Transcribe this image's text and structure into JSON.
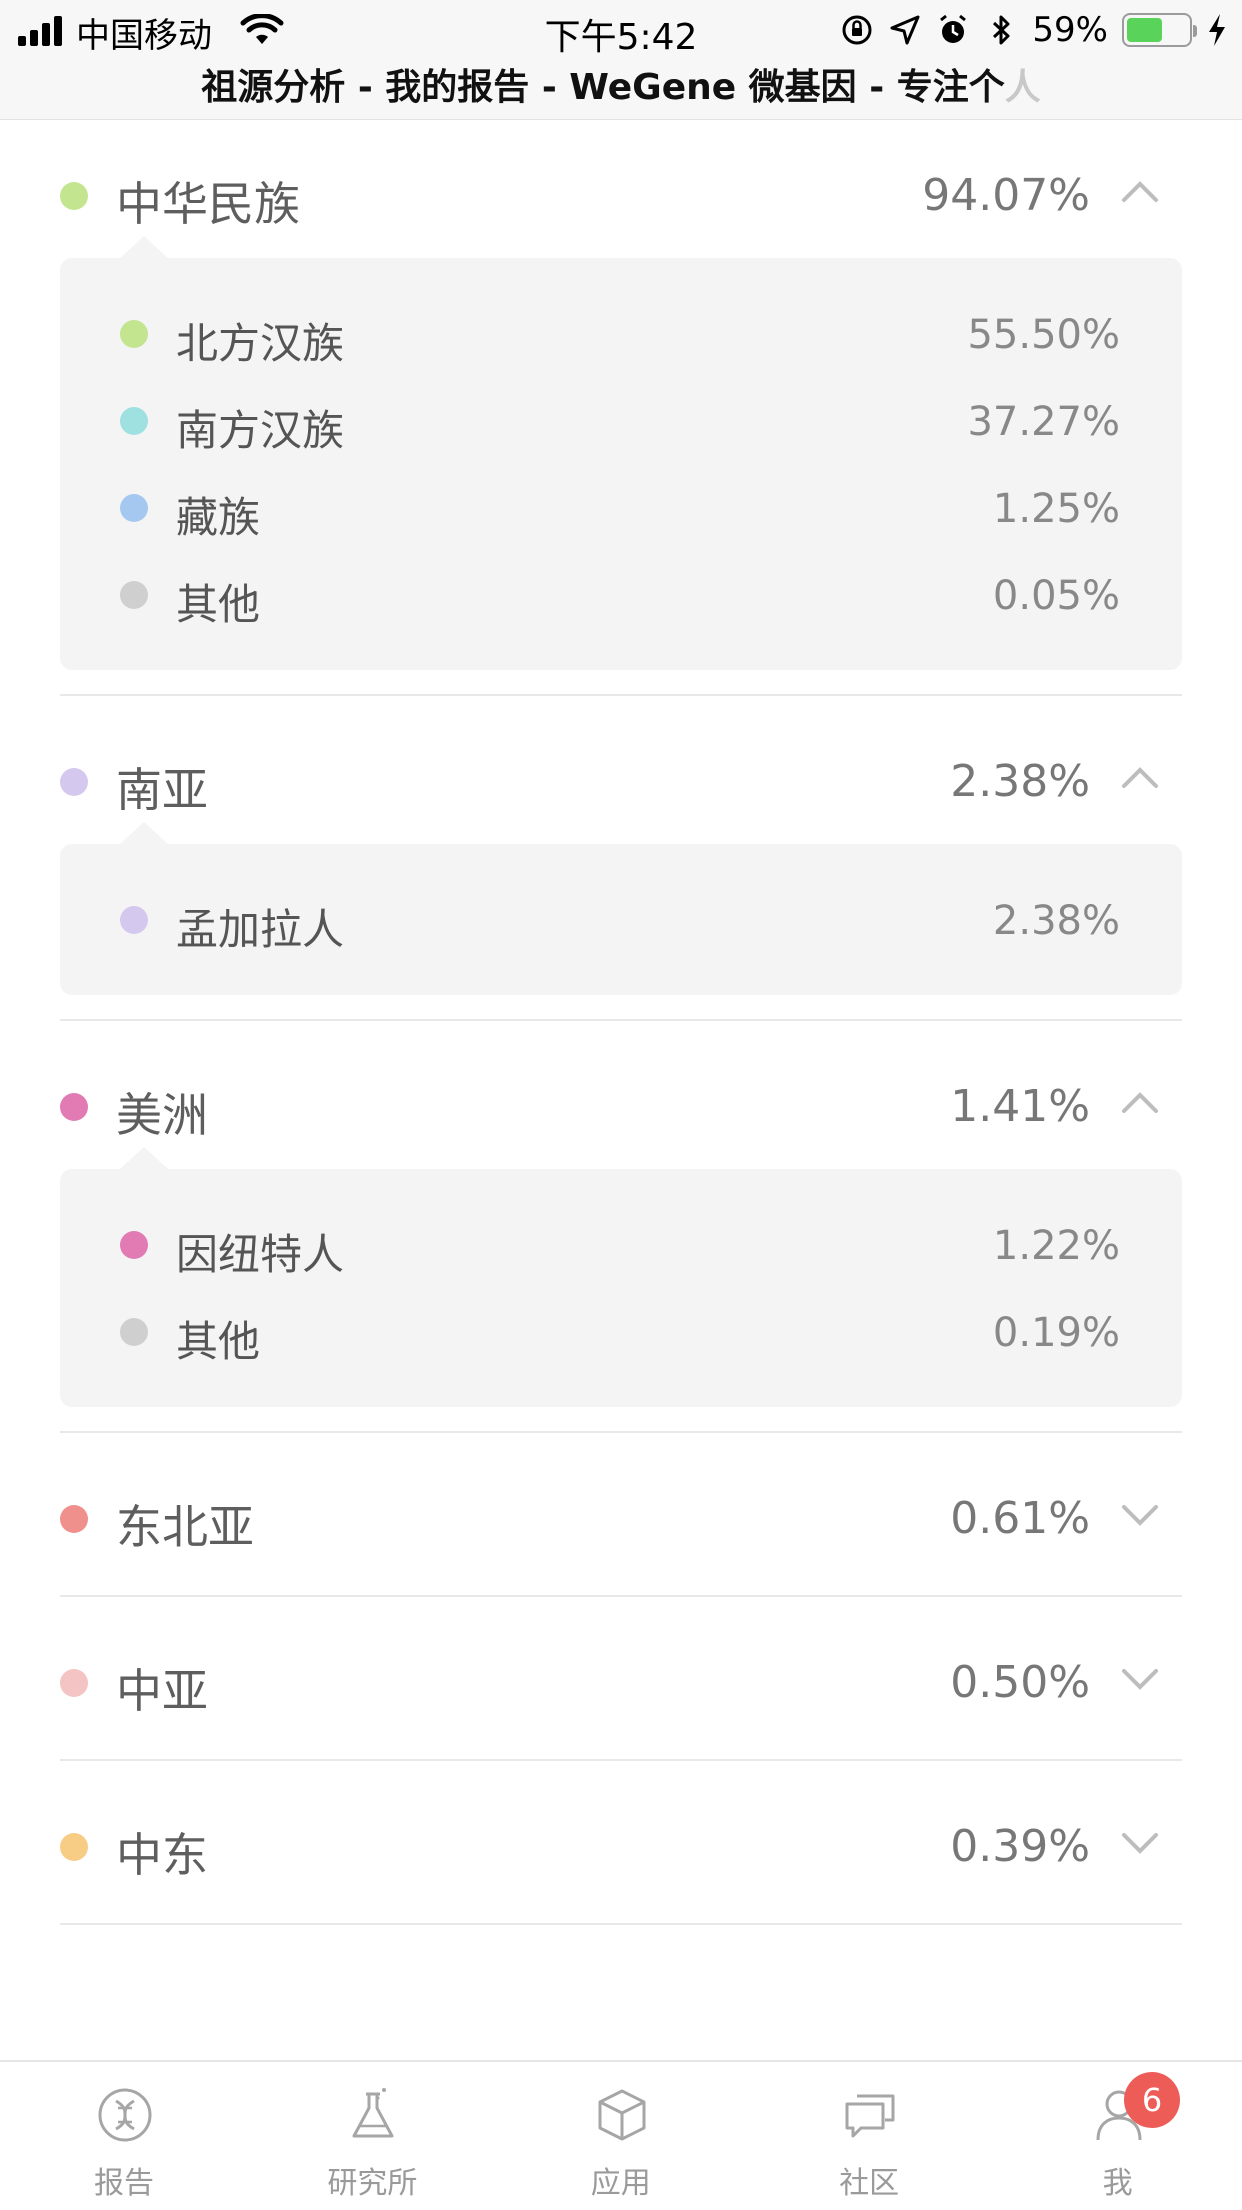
{
  "status_bar": {
    "carrier": "中国移动",
    "time": "下午5:42",
    "battery_percent": "59%",
    "battery_level": 0.59,
    "battery_color": "#5ad35a"
  },
  "page_title": {
    "text": "祖源分析 - 我的报告 - WeGene 微基因 - 专注个",
    "faded_tail": "人"
  },
  "groups": [
    {
      "name": "中华民族",
      "percent": "94.07%",
      "color": "#c4e58f",
      "expanded": true,
      "items": [
        {
          "name": "北方汉族",
          "percent": "55.50%",
          "color": "#c4e58f"
        },
        {
          "name": "南方汉族",
          "percent": "37.27%",
          "color": "#9fe0e0"
        },
        {
          "name": "藏族",
          "percent": "1.25%",
          "color": "#a4c8f0"
        },
        {
          "name": "其他",
          "percent": "0.05%",
          "color": "#cfcfcf"
        }
      ]
    },
    {
      "name": "南亚",
      "percent": "2.38%",
      "color": "#d5c8ef",
      "expanded": true,
      "items": [
        {
          "name": "孟加拉人",
          "percent": "2.38%",
          "color": "#d5c8ef"
        }
      ]
    },
    {
      "name": "美洲",
      "percent": "1.41%",
      "color": "#e27bb4",
      "expanded": true,
      "items": [
        {
          "name": "因纽特人",
          "percent": "1.22%",
          "color": "#e27bb4"
        },
        {
          "name": "其他",
          "percent": "0.19%",
          "color": "#cfcfcf"
        }
      ]
    },
    {
      "name": "东北亚",
      "percent": "0.61%",
      "color": "#f0908c",
      "expanded": false,
      "items": []
    },
    {
      "name": "中亚",
      "percent": "0.50%",
      "color": "#f4c3c3",
      "expanded": false,
      "items": []
    },
    {
      "name": "中东",
      "percent": "0.39%",
      "color": "#f7cd86",
      "expanded": false,
      "items": []
    }
  ],
  "tabs": [
    {
      "label": "报告",
      "icon": "dna-report-icon"
    },
    {
      "label": "研究所",
      "icon": "flask-icon"
    },
    {
      "label": "应用",
      "icon": "cube-icon"
    },
    {
      "label": "社区",
      "icon": "chat-bubbles-icon"
    },
    {
      "label": "我",
      "icon": "user-icon"
    }
  ],
  "me_badge": "6",
  "badge_color": "#ee5c58"
}
